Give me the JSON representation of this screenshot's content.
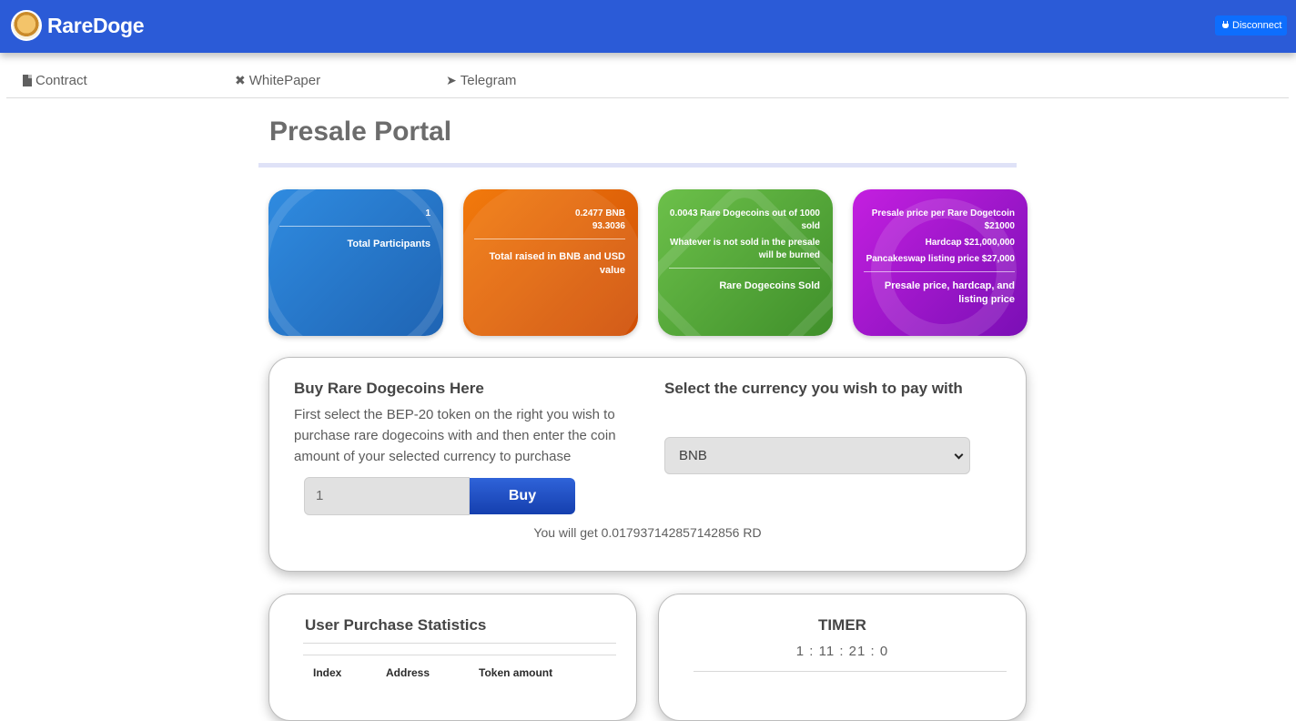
{
  "header": {
    "brand": "RareDoge",
    "disconnect_label": "Disconnect"
  },
  "nav": {
    "contract": "Contract",
    "whitepaper": "WhitePaper",
    "telegram": "Telegram"
  },
  "page": {
    "title": "Presale Portal"
  },
  "cards": {
    "participants": {
      "value": "1",
      "label": "Total Participants"
    },
    "raised": {
      "bnb": "0.2477 BNB",
      "usd": "93.3036",
      "label": "Total raised in BNB and USD value"
    },
    "sold": {
      "line1": "0.0043 Rare Dogecoins out of 1000 sold",
      "line2": "Whatever is not sold in the presale will be burned",
      "label": "Rare Dogecoins Sold"
    },
    "pricing": {
      "presale": "Presale price per Rare Dogetcoin $21000",
      "hardcap": "Hardcap $21,000,000",
      "listing": "Pancakeswap listing price $27,000",
      "label": "Presale price, hardcap, and listing price"
    }
  },
  "buy": {
    "title": "Buy Rare Dogecoins Here",
    "description": "First select the BEP-20 token on the right you wish to purchase rare dogecoins with and then enter the coin amount of your selected currency to purchase",
    "amount_value": "1",
    "buy_label": "Buy",
    "result": "You will get 0.017937142857142856 RD",
    "currency_title": "Select the currency you wish to pay with",
    "currency_selected": "BNB"
  },
  "stats": {
    "title": "User Purchase Statistics",
    "columns": [
      "Index",
      "Address",
      "Token amount"
    ]
  },
  "timer": {
    "title": "TIMER",
    "value": "1 : 11 : 21 : 0"
  }
}
